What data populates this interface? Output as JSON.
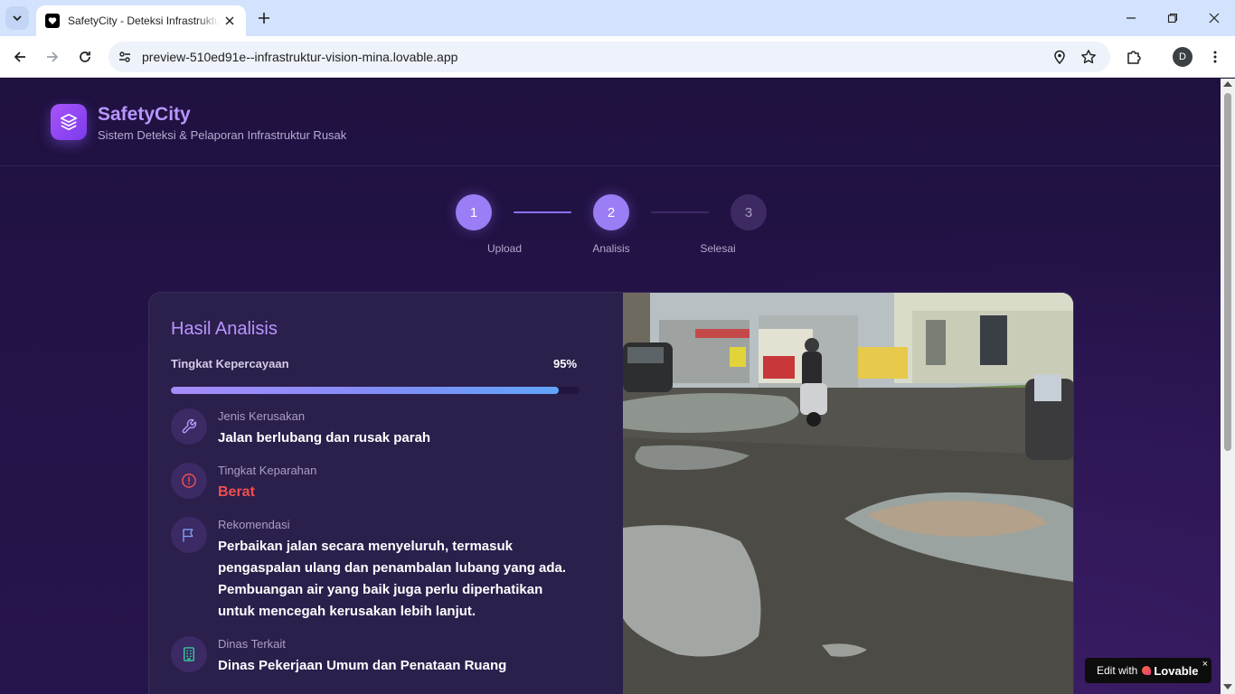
{
  "browser": {
    "tab_title": "SafetyCity - Deteksi Infrastruktur",
    "url": "preview-510ed91e--infrastruktur-vision-mina.lovable.app",
    "profile_initial": "D"
  },
  "header": {
    "brand": "SafetyCity",
    "tagline": "Sistem Deteksi & Pelaporan Infrastruktur Rusak"
  },
  "stepper": {
    "current_step": 2,
    "steps": [
      {
        "number": "1",
        "label": "Upload"
      },
      {
        "number": "2",
        "label": "Analisis"
      },
      {
        "number": "3",
        "label": "Selesai"
      }
    ]
  },
  "result": {
    "title": "Hasil Analisis",
    "confidence_label": "Tingkat Kepercayaan",
    "confidence_value": "95%",
    "confidence_fraction": 0.95,
    "items": [
      {
        "icon": "wrench-icon",
        "label": "Jenis Kerusakan",
        "value": "Jalan berlubang dan rusak parah"
      },
      {
        "icon": "alert-circle-icon",
        "label": "Tingkat Keparahan",
        "value": "Berat"
      },
      {
        "icon": "flag-icon",
        "label": "Rekomendasi",
        "value": "Perbaikan jalan secara menyeluruh, termasuk pengaspalan ulang dan penambalan lubang yang ada. Pembuangan air yang baik juga perlu diperhatikan untuk mencegah kerusakan lebih lanjut."
      },
      {
        "icon": "building-icon",
        "label": "Dinas Terkait",
        "value": "Dinas Pekerjaan Umum dan Penataan Ruang"
      }
    ]
  },
  "badge": {
    "prefix": "Edit with",
    "name": "Lovable",
    "close": "×"
  },
  "colors": {
    "accent": "#9b7df6",
    "brand": "#b896ff",
    "severity": "#f04f4f",
    "page_bg": "#1e1238",
    "card_bg": "#2b1f4c"
  }
}
